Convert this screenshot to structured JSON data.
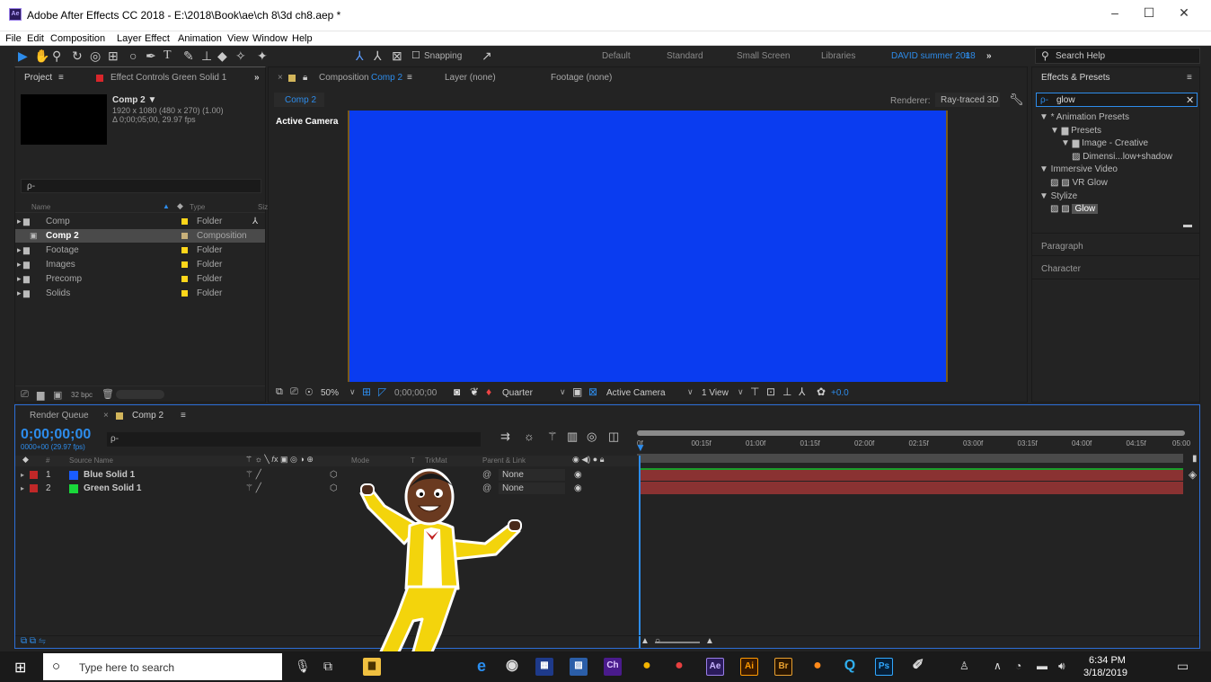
{
  "window": {
    "title": "Adobe After Effects CC 2018 - E:\\2018\\Book\\ae\\ch 8\\3d ch8.aep *",
    "app_icon": "Ae",
    "controls": [
      "–",
      "☐",
      "✕"
    ]
  },
  "menu": [
    "File",
    "Edit",
    "Composition",
    "Layer",
    "Effect",
    "Animation",
    "View",
    "Window",
    "Help"
  ],
  "toolbar": {
    "snapping_label": "Snapping",
    "workspaces": [
      "Default",
      "Standard",
      "Small Screen",
      "Libraries"
    ],
    "active_workspace": "DAVID summer 2018",
    "search_label": "Search Help"
  },
  "project_panel": {
    "tab": "Project",
    "effect_controls_tab": "Effect Controls Green Solid 1",
    "comp_name": "Comp 2 ▼",
    "comp_res": "1920 x 1080  (480 x 270) (1.00)",
    "comp_duration": "Δ 0;00;05;00, 29.97 fps",
    "search_placeholder": "ρ-",
    "columns": [
      "Name",
      "Type",
      "Siz"
    ],
    "items": [
      {
        "name": "Comp",
        "type": "Folder",
        "color": "#ffd61a"
      },
      {
        "name": "Comp 2",
        "type": "Composition",
        "color": "#c8b07a"
      },
      {
        "name": "Footage",
        "type": "Folder",
        "color": "#ffd61a"
      },
      {
        "name": "Images",
        "type": "Folder",
        "color": "#ffd61a"
      },
      {
        "name": "Precomp",
        "type": "Folder",
        "color": "#ffd61a"
      },
      {
        "name": "Solids",
        "type": "Folder",
        "color": "#ffd61a"
      }
    ],
    "bpc": "32 bpc"
  },
  "composition_panel": {
    "tab_prefix": "Composition",
    "tab_name": "Comp 2",
    "layer_tab": "Layer (none)",
    "footage_tab": "Footage (none)",
    "sub_tab": "Comp 2",
    "renderer_label": "Renderer:",
    "renderer": "Ray-traced 3D",
    "active_camera_label": "Active Camera",
    "viewer_color": "#0a3cf0",
    "zoom": "50%",
    "timecode": "0;00;00;00",
    "resolution": "Quarter",
    "view": "Active Camera",
    "views": "1 View",
    "exposure": "+0.0"
  },
  "timeline": {
    "render_queue_tab": "Render Queue",
    "comp_tab": "Comp 2",
    "timecode": "0;00;00;00",
    "timecode_sub": "0000+00 (29.97 fps)",
    "search_placeholder": "ρ-",
    "columns": {
      "num": "#",
      "source_name": "Source Name",
      "mode": "Mode",
      "t": "T",
      "trkmat": "TrkMat",
      "parent": "Parent & Link"
    },
    "ruler": [
      "0f",
      "00:15f",
      "01:00f",
      "01:15f",
      "02:00f",
      "02:15f",
      "03:00f",
      "03:15f",
      "04:00f",
      "04:15f",
      "05:00"
    ],
    "layers": [
      {
        "num": "1",
        "name": "Blue Solid 1",
        "color": "#1a5cff",
        "parent": "None"
      },
      {
        "num": "2",
        "name": "Green Solid 1",
        "color": "#19d83a",
        "parent": "None"
      }
    ]
  },
  "effects_presets": {
    "title": "Effects & Presets",
    "search_value": "glow",
    "tree": [
      {
        "label": "▼ * Animation Presets",
        "indent": 0
      },
      {
        "label": "▼ ▆ Presets",
        "indent": 1
      },
      {
        "label": "▼ ▆ Image - Creative",
        "indent": 2
      },
      {
        "label": "Dimensi...low+shadow",
        "indent": 3
      },
      {
        "label": "▼ Immersive Video",
        "indent": 0
      },
      {
        "label": "VR Glow",
        "indent": 1
      },
      {
        "label": "▼ Stylize",
        "indent": 0
      },
      {
        "label": "Glow",
        "indent": 1
      }
    ],
    "paragraph": "Paragraph",
    "character": "Character"
  },
  "taskbar": {
    "search_placeholder": "Type here to search",
    "time": "6:34 PM",
    "date": "3/18/2019",
    "apps": [
      {
        "label": "Ch",
        "color": "#4a1b8c"
      },
      {
        "label": "Ae",
        "color": "#2b1b5c"
      },
      {
        "label": "Ai",
        "color": "#3a1a00"
      },
      {
        "label": "Br",
        "color": "#2a1600"
      },
      {
        "label": "Ps",
        "color": "#061e36"
      }
    ]
  }
}
